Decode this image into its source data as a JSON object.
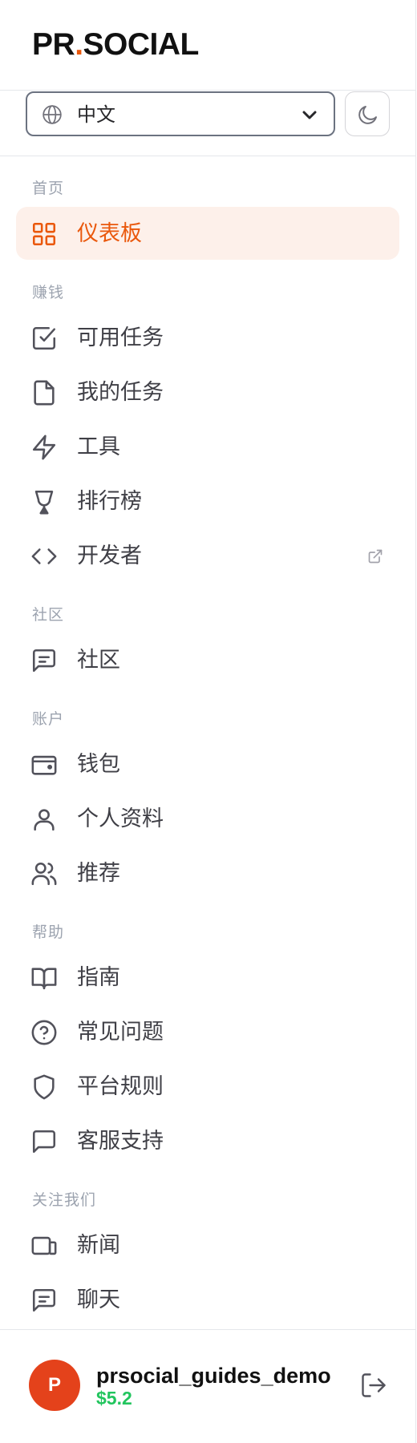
{
  "brand": {
    "logo_left": "PR",
    "logo_dot": ".",
    "logo_right": "SOCIAL"
  },
  "language": {
    "icon": "globe-icon",
    "value": "中文",
    "chevron": "chevron-down-icon"
  },
  "theme_toggle": {
    "icon": "moon-icon"
  },
  "sections": [
    {
      "label": "首页",
      "items": [
        {
          "label": "仪表板",
          "icon": "grid-icon",
          "active": true
        }
      ]
    },
    {
      "label": "赚钱",
      "items": [
        {
          "label": "可用任务",
          "icon": "checkbox-icon"
        },
        {
          "label": "我的任务",
          "icon": "file-icon"
        },
        {
          "label": "工具",
          "icon": "lightning-icon"
        },
        {
          "label": "排行榜",
          "icon": "trophy-icon"
        },
        {
          "label": "开发者",
          "icon": "code-icon",
          "external": true
        }
      ]
    },
    {
      "label": "社区",
      "items": [
        {
          "label": "社区",
          "icon": "message-square-text-icon"
        }
      ]
    },
    {
      "label": "账户",
      "items": [
        {
          "label": "钱包",
          "icon": "wallet-icon"
        },
        {
          "label": "个人资料",
          "icon": "user-icon"
        },
        {
          "label": "推荐",
          "icon": "users-icon"
        }
      ]
    },
    {
      "label": "帮助",
      "items": [
        {
          "label": "指南",
          "icon": "book-open-icon"
        },
        {
          "label": "常见问题",
          "icon": "help-circle-icon"
        },
        {
          "label": "平台规则",
          "icon": "shield-icon"
        },
        {
          "label": "客服支持",
          "icon": "message-square-icon"
        }
      ]
    },
    {
      "label": "关注我们",
      "items": [
        {
          "label": "新闻",
          "icon": "news-devices-icon"
        },
        {
          "label": "聊天",
          "icon": "chat-icon"
        }
      ]
    }
  ],
  "user": {
    "avatar_initial": "P",
    "username": "prsocial_guides_demo",
    "balance": "$5.2"
  },
  "colors": {
    "accent": "#ea580c",
    "active_bg": "#fdf0ea",
    "balance": "#22c55e",
    "avatar": "#e4421b"
  }
}
